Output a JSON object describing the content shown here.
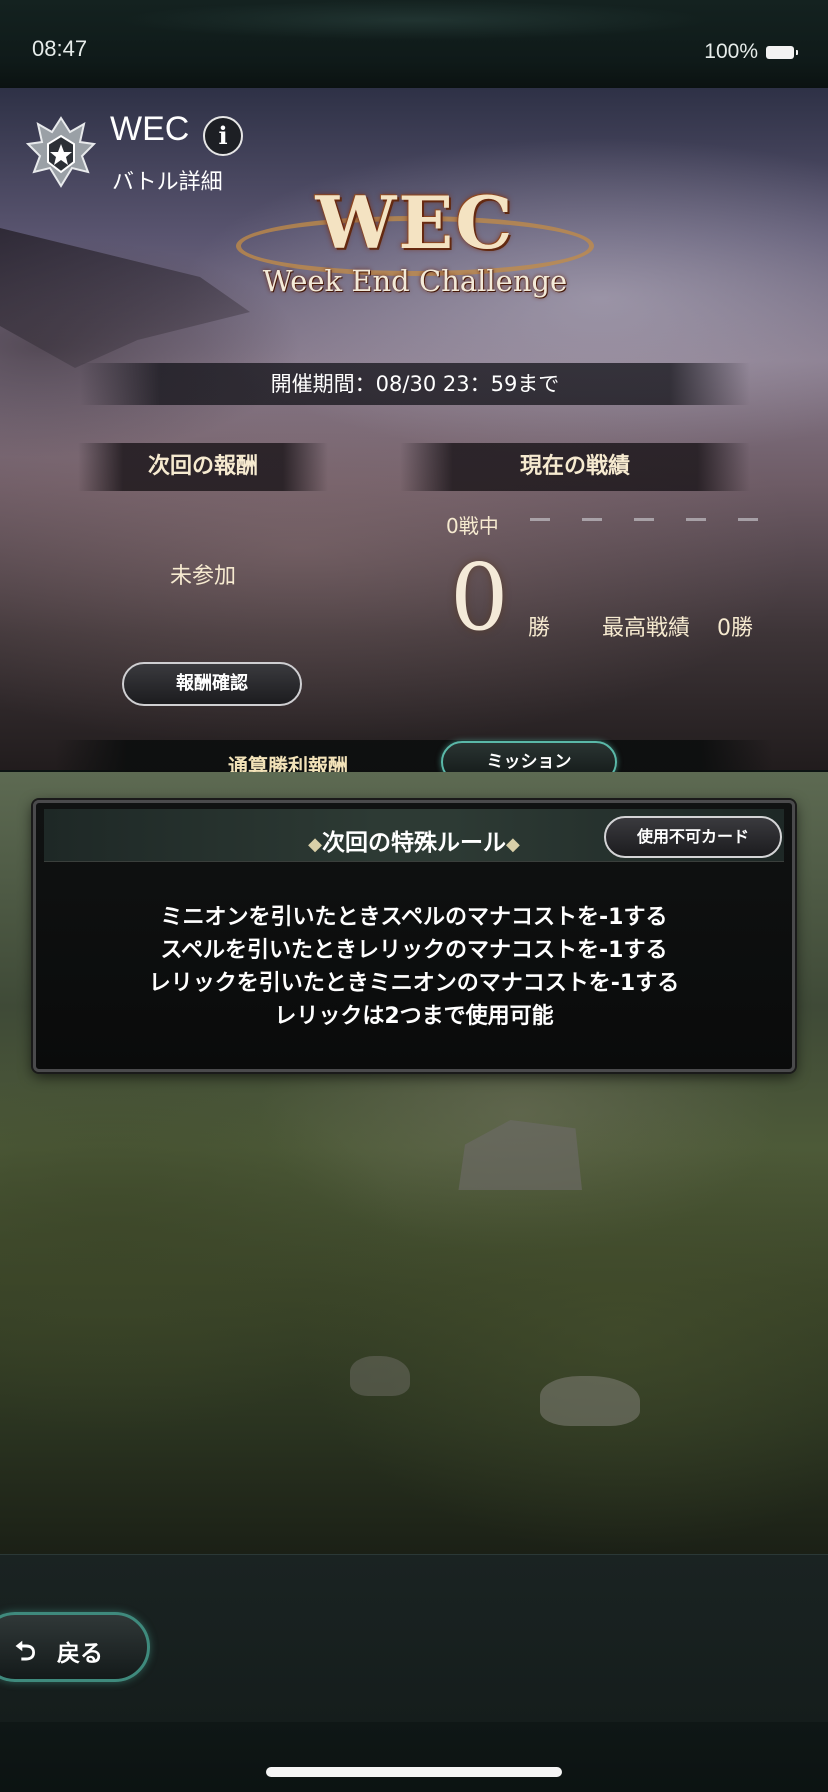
{
  "status_bar": {
    "time": "08:47",
    "battery": "100%"
  },
  "header": {
    "title": "WEC",
    "subtitle": "バトル詳細",
    "info_icon": "info-icon"
  },
  "event_logo": {
    "main": "WEC",
    "sub": "Week End Challenge"
  },
  "period": "開催期間：08/30 23：59まで",
  "next_reward": {
    "heading": "次回の報酬",
    "status": "未参加",
    "button_label": "報酬確認"
  },
  "current_record": {
    "heading": "現在の戦績",
    "in_progress": "0戦中",
    "progress_slots": 5,
    "wins": "0",
    "wins_unit": "勝",
    "best_label": "最高戦績",
    "best_value": "0勝"
  },
  "tabs": [
    {
      "label": "通算勝利報酬",
      "selected": false
    },
    {
      "label": "ミッション",
      "selected": true
    }
  ],
  "rules_panel": {
    "title": "次回の特殊ルール",
    "banned_cards_button": "使用不可カード",
    "rules": [
      "ミニオンを引いたときスペルのマナコストを-1する",
      "スペルを引いたときレリックのマナコストを-1する",
      "レリックを引いたときミニオンのマナコストを-1する",
      "レリックは2つまで使用可能"
    ]
  },
  "footer": {
    "back_label": "戻る",
    "back_icon": "return-arrow-icon"
  },
  "colors": {
    "accent_teal": "#5ab8a8",
    "gold_text": "#f6ead0"
  }
}
